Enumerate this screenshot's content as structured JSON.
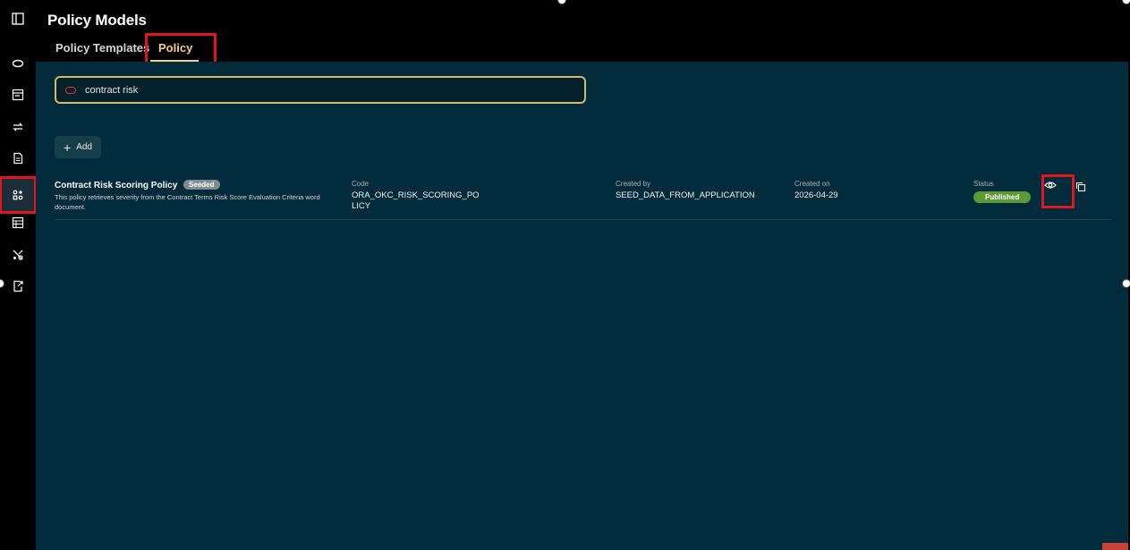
{
  "header": {
    "title": "Policy Models",
    "tabs": [
      {
        "label": "Policy Templates",
        "active": false
      },
      {
        "label": "Policy",
        "active": true
      }
    ]
  },
  "rail": {
    "items": [
      {
        "icon": "sidebar-toggle-icon"
      },
      {
        "icon": "home-icon"
      },
      {
        "icon": "inbox-icon"
      },
      {
        "icon": "sync-icon"
      },
      {
        "icon": "document-icon"
      },
      {
        "icon": "policy-models-icon",
        "active": true
      },
      {
        "icon": "table-icon"
      },
      {
        "icon": "tools-icon"
      },
      {
        "icon": "export-icon"
      }
    ]
  },
  "search": {
    "value": "contract risk"
  },
  "toolbar": {
    "add_label": "Add"
  },
  "policies": [
    {
      "name": "Contract Risk Scoring Policy",
      "badge": "Seeded",
      "description": "This policy retrieves severity from the Contract Terms Risk Score Evaluation Criteria word document.",
      "code_label": "Code",
      "code": "ORA_OKC_RISK_SCORING_POLICY",
      "created_by_label": "Created by",
      "created_by": "SEED_DATA_FROM_APPLICATION",
      "created_on_label": "Created on",
      "created_on": "2026-04-29",
      "status_label": "Status",
      "status": "Published"
    }
  ],
  "colors": {
    "accent": "#f1d280",
    "highlight": "#e3161d",
    "panel": "#022c3b",
    "status_published": "#5d9a37"
  }
}
